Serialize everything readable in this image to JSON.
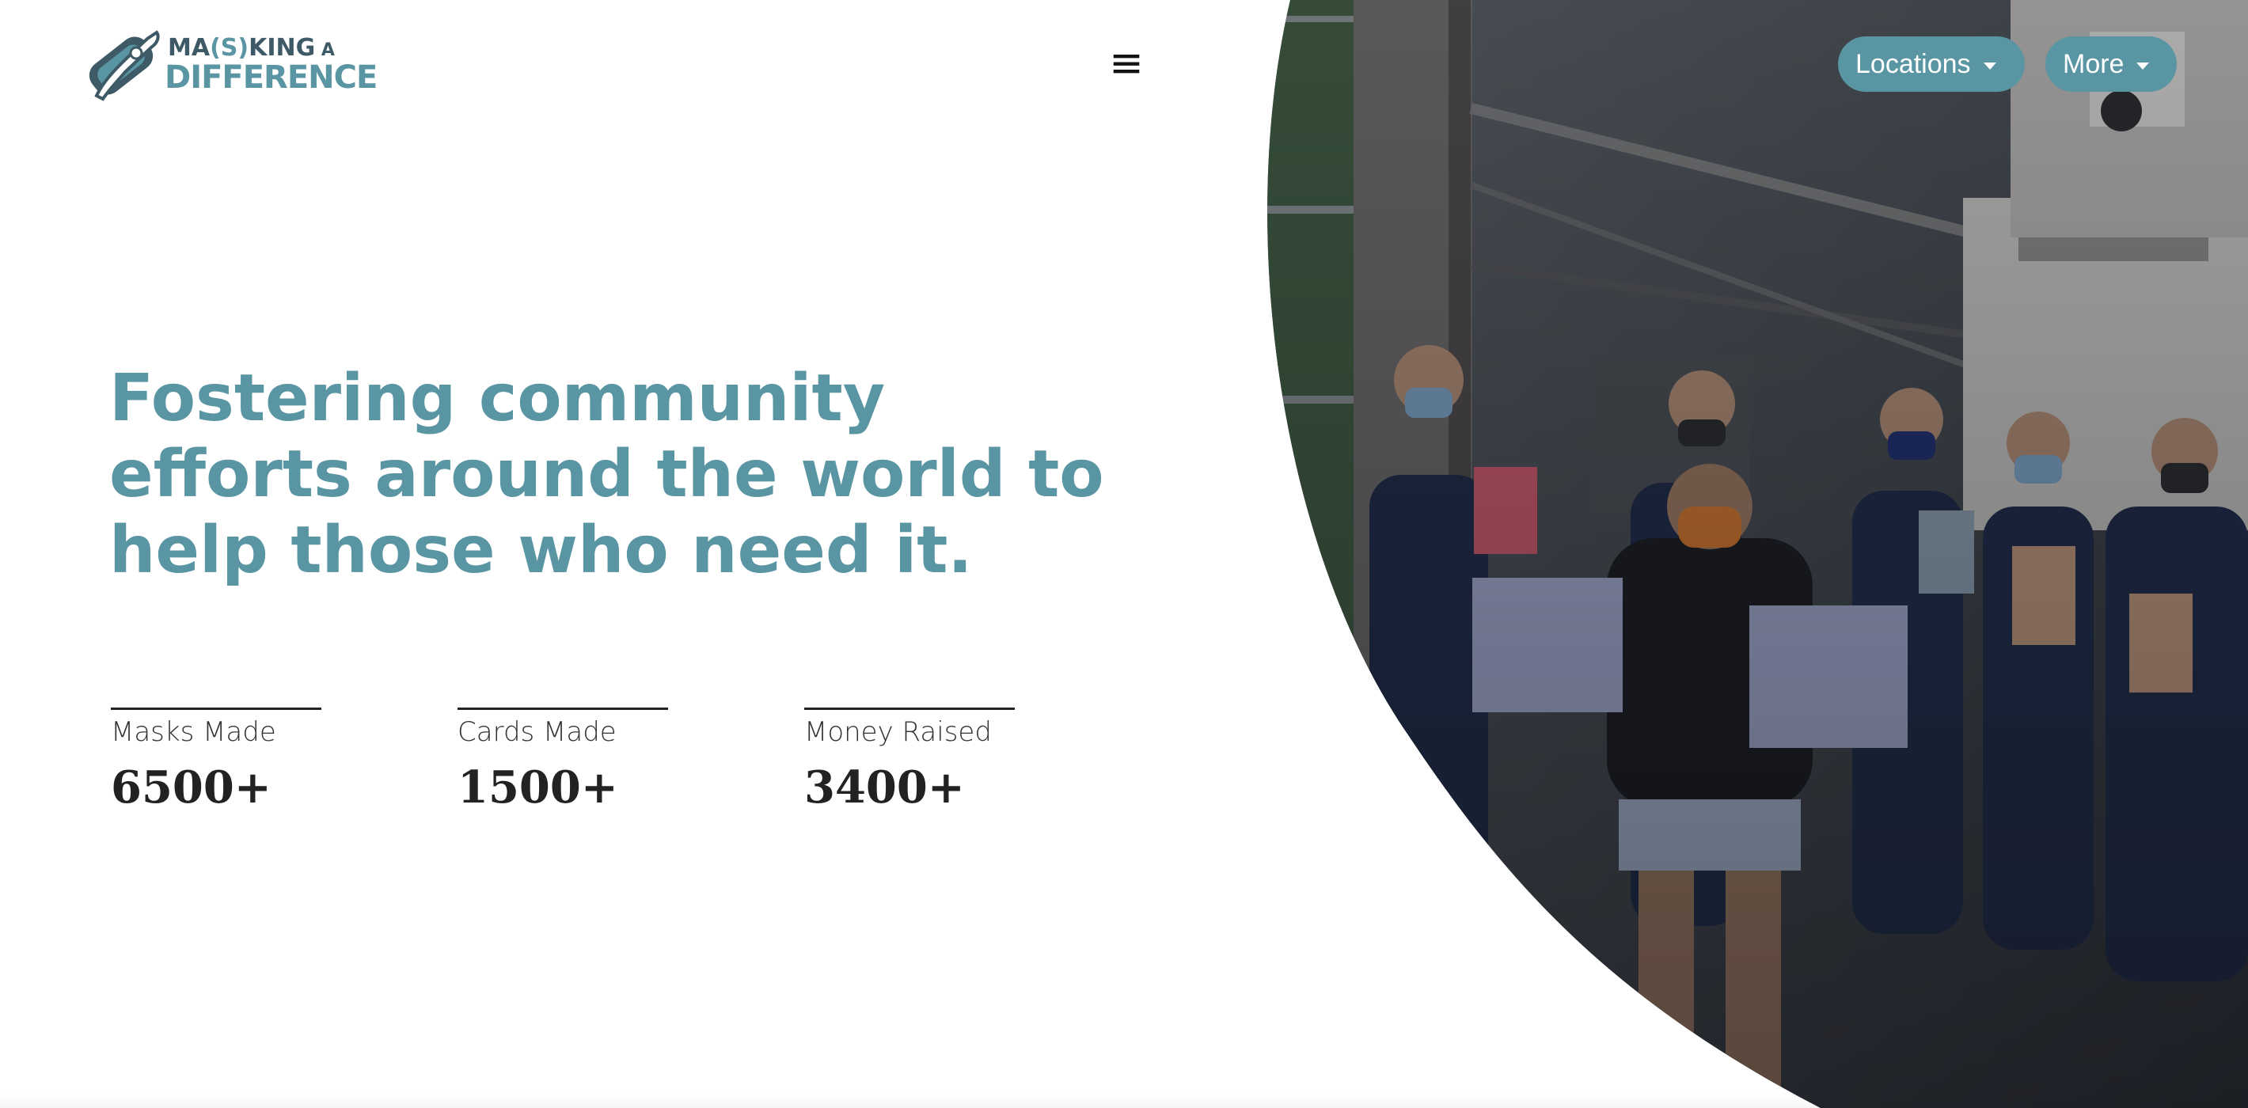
{
  "brand": {
    "logo_line1_a": "MA",
    "logo_line1_paren": "(S)",
    "logo_line1_b": "KING",
    "logo_line1_small": " A",
    "logo_line2": "DIFFERENCE",
    "primary_color": "#5a95a3",
    "dark_color": "#3d5a66"
  },
  "header": {
    "menu_icon": "hamburger-icon",
    "menu_glyph": "≡",
    "nav": [
      {
        "label": "Locations",
        "icon": "chevron-down-icon"
      },
      {
        "label": "More",
        "icon": "chevron-down-icon"
      }
    ]
  },
  "hero": {
    "headline": "Fostering community efforts around the world to help those who need it.",
    "photo": "group-photo-firefighters-holding-masks-and-cards"
  },
  "stats": [
    {
      "label": "Masks Made",
      "value": "6500+"
    },
    {
      "label": "Cards Made",
      "value": "1500+"
    },
    {
      "label": "Money Raised",
      "value": "3400+"
    }
  ]
}
